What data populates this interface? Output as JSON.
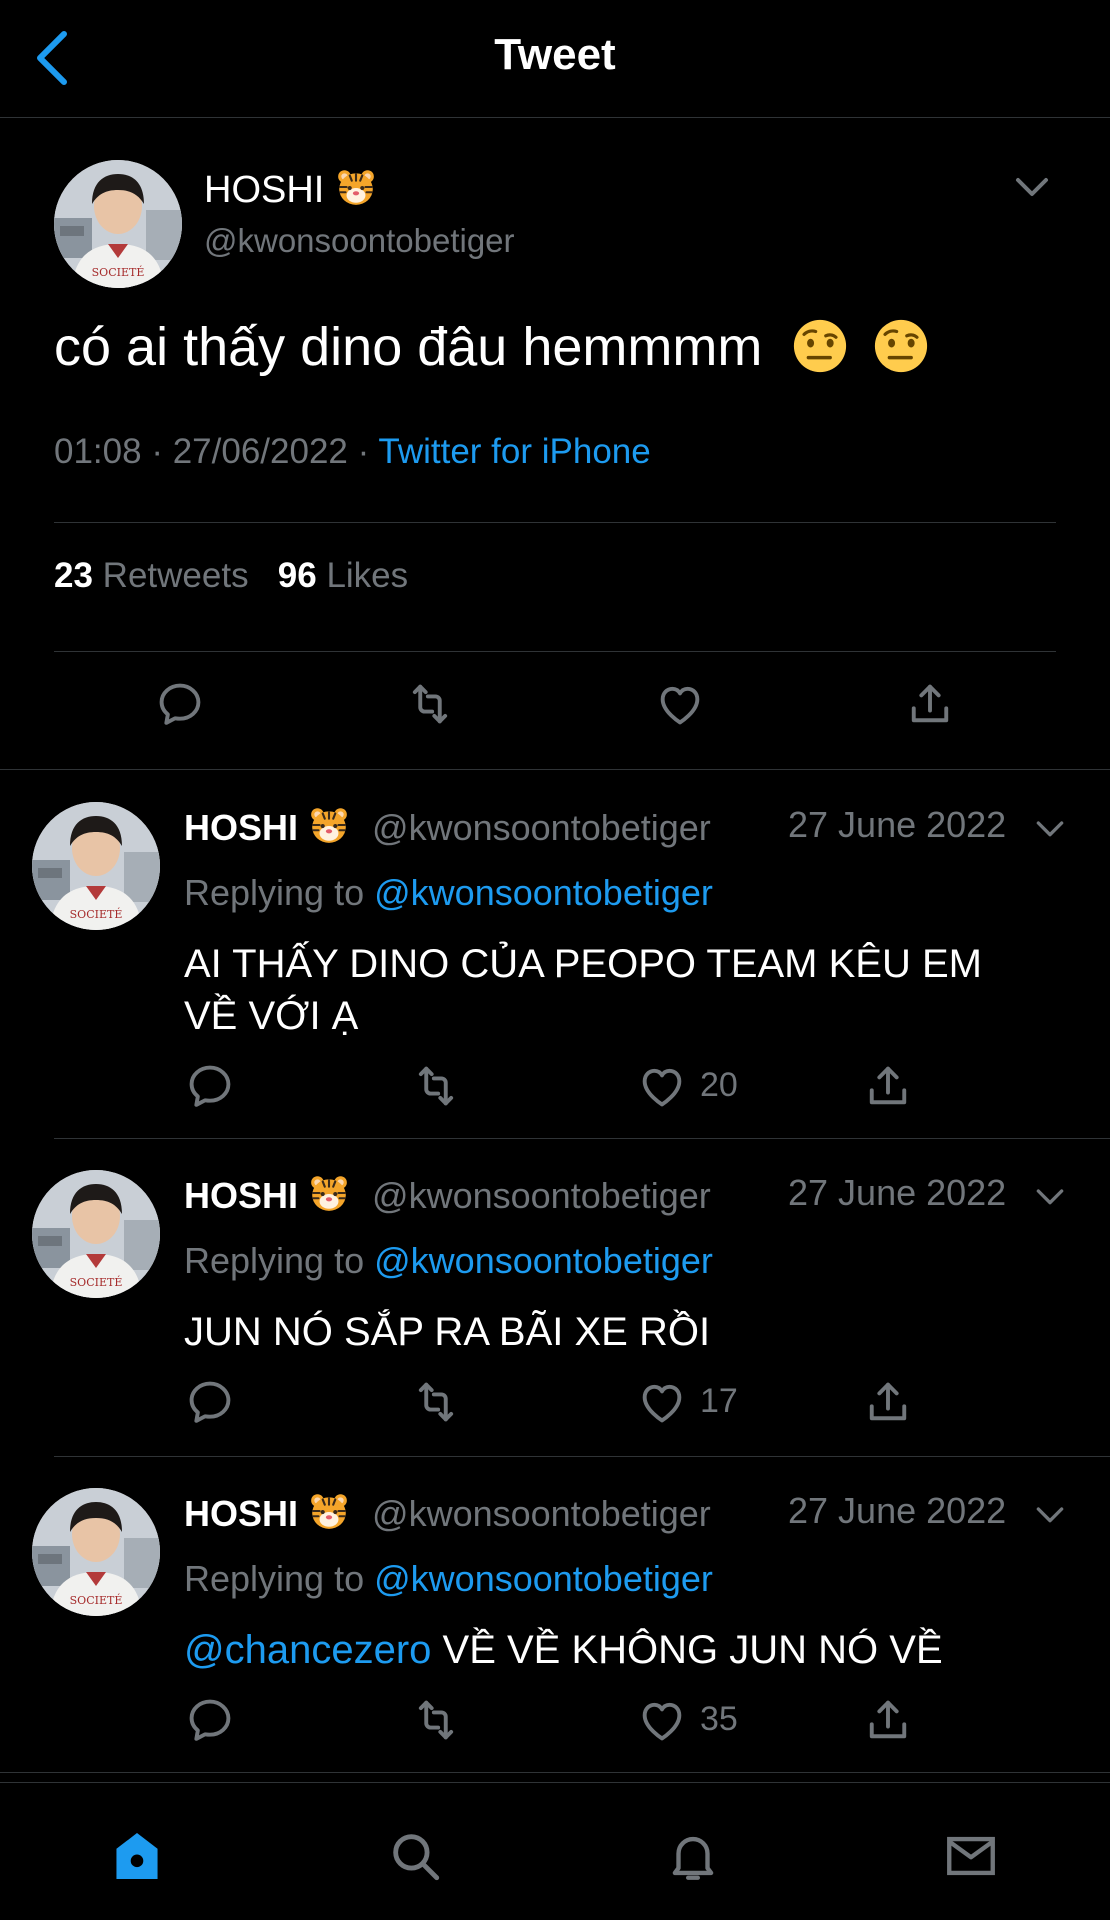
{
  "header": {
    "title": "Tweet"
  },
  "main_tweet": {
    "name": "HOSHI",
    "handle": "@kwonsoontobetiger",
    "text": "có ai thấy dino đâu hemmmm",
    "time": "01:08",
    "date": "27/06/2022",
    "source": "Twitter for iPhone",
    "retweets": "23",
    "retweets_label": "Retweets",
    "likes": "96",
    "likes_label": "Likes"
  },
  "replies": [
    {
      "name": "HOSHI",
      "handle": "@kwonsoontobetiger",
      "date": "27 June 2022",
      "replying_label": "Replying to",
      "replying_to": "@kwonsoontobetiger",
      "mention": "",
      "text": "AI THẤY DINO CỦA PEOPO TEAM KÊU EM VỀ VỚI Ạ",
      "likes": "20"
    },
    {
      "name": "HOSHI",
      "handle": "@kwonsoontobetiger",
      "date": "27 June 2022",
      "replying_label": "Replying to",
      "replying_to": "@kwonsoontobetiger",
      "mention": "",
      "text": "JUN NÓ SẮP RA BÃI XE RỒI",
      "likes": "17"
    },
    {
      "name": "HOSHI",
      "handle": "@kwonsoontobetiger",
      "date": "27 June 2022",
      "replying_label": "Replying to",
      "replying_to": "@kwonsoontobetiger",
      "mention": "@chancezero",
      "text": "VỀ VỀ KHÔNG JUN NÓ VỀ",
      "likes": "35"
    }
  ],
  "colors": {
    "accent": "#1d9bf0",
    "muted": "#71767b",
    "background": "#000000",
    "divider": "#2f3336"
  },
  "icons": [
    "back-chevron-icon",
    "chevron-down-icon",
    "reply-icon",
    "retweet-icon",
    "like-icon",
    "share-icon",
    "home-icon",
    "search-icon",
    "notifications-icon",
    "messages-icon",
    "tiger-emoji-icon",
    "raised-eyebrow-emoji-icon"
  ]
}
